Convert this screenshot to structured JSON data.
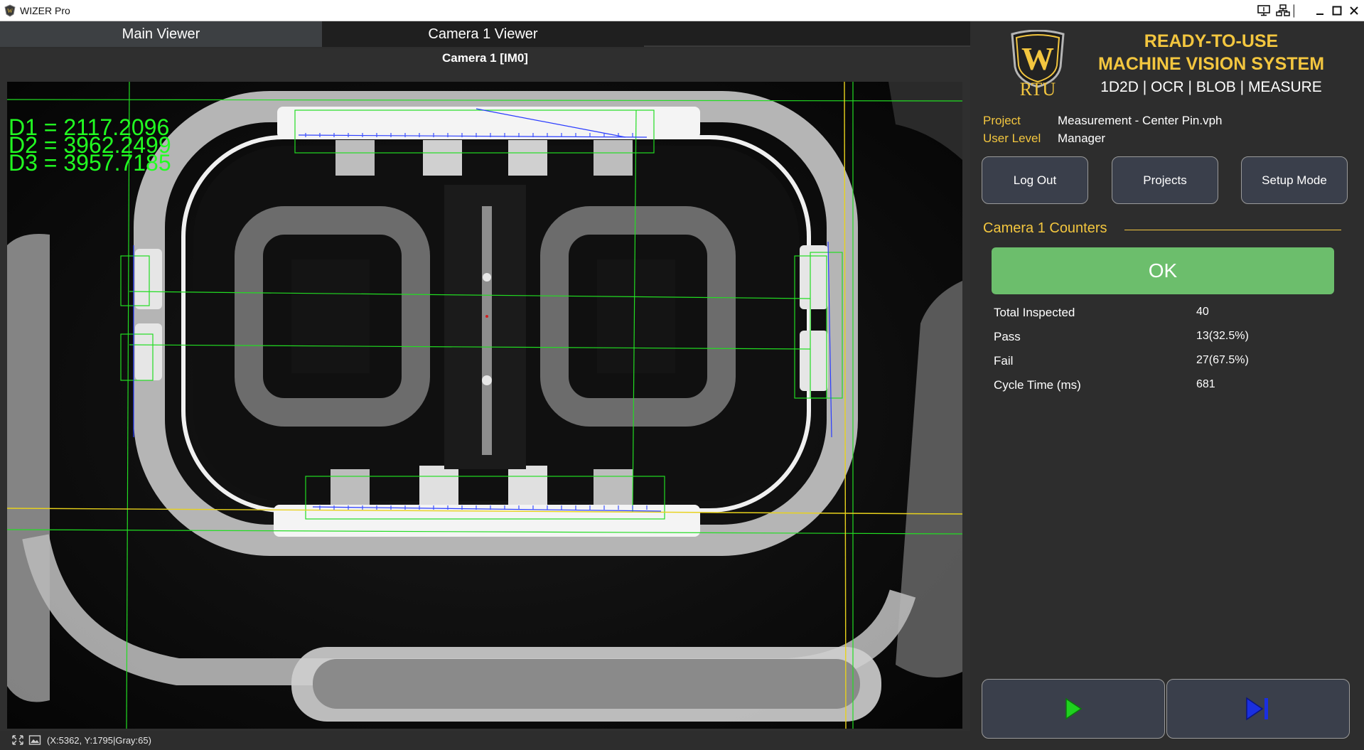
{
  "window": {
    "title": "WIZER Pro",
    "controls": [
      "monitor-icon",
      "network-icon",
      "minimize-icon",
      "maximize-icon",
      "close-icon"
    ]
  },
  "tabs": [
    {
      "label": "Main Viewer",
      "active": true
    },
    {
      "label": "Camera 1 Viewer",
      "active": false
    }
  ],
  "viewer": {
    "title": "Camera 1  [IM0]",
    "measurements": [
      "D1 = 2117.2096",
      "D2 = 3962.2499",
      "D3 = 3957.7185"
    ],
    "overlay_color": "#22ff22"
  },
  "statusbar": {
    "coords": "(X:5362, Y:1795|Gray:65)"
  },
  "brand": {
    "logo_text": "RTU",
    "logo_letter": "W",
    "line1": "READY-TO-USE",
    "line2": "MACHINE VISION SYSTEM",
    "line3": "1D2D | OCR | BLOB | MEASURE",
    "accent": "#f3c63f"
  },
  "info": {
    "project_label": "Project",
    "project_value": "Measurement - Center Pin.vph",
    "user_label": "User Level",
    "user_value": "Manager"
  },
  "buttons": {
    "logout": "Log Out",
    "projects": "Projects",
    "setup": "Setup Mode"
  },
  "counters": {
    "title": "Camera 1 Counters",
    "status": "OK",
    "status_color": "#6cbe6c",
    "rows": [
      {
        "label": "Total Inspected",
        "value": "40"
      },
      {
        "label": "Pass",
        "value": "13(32.5%)"
      },
      {
        "label": "Fail",
        "value": "27(67.5%)"
      },
      {
        "label": "Cycle Time (ms)",
        "value": "681"
      }
    ]
  },
  "run_controls": {
    "play_icon": "play-icon",
    "step_icon": "step-forward-icon",
    "play_color": "#1fd11f",
    "step_color": "#1a2fe0"
  }
}
